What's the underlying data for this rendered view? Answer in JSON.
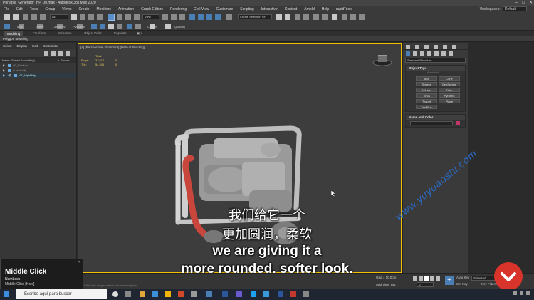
{
  "window": {
    "title": "Portable_Generator_HP_00.max - Autodesk 3ds Max 2020",
    "controls": [
      "–",
      "□",
      "✕"
    ]
  },
  "menu": {
    "items": [
      "File",
      "Edit",
      "Tools",
      "Group",
      "Views",
      "Create",
      "Modifiers",
      "Animation",
      "Graph Editors",
      "Rendering",
      "Civil View",
      "Customize",
      "Scripting",
      "Interactive",
      "Content",
      "Arnold",
      "Help",
      "rapidTools"
    ],
    "workspaces_label": "Workspaces:",
    "workspace_value": "Default"
  },
  "toolbar": {
    "filter_value": "All",
    "view_value": "View",
    "selection_set_value": "Create Selection Se",
    "labels": [
      "8Box",
      "SetPiv",
      "CenterPiv",
      "PivButton",
      "Copitor",
      "Quadrify"
    ]
  },
  "ribbon": {
    "tabs": [
      "Modeling",
      "Freeform",
      "Selection",
      "Object Paint",
      "Populate"
    ],
    "subtab": "Polygon Modeling"
  },
  "explorer": {
    "menu": [
      "Select",
      "Display",
      "Edit",
      "Customize"
    ],
    "col_name": "Name (Sorted Ascending)",
    "col_frozen": "▲ Frozen",
    "rows": [
      "00_Blockout",
      "0 (default)",
      "01_HighPoly"
    ]
  },
  "viewport": {
    "label": "[+] [Perspective] [Standard] [Default Shading]",
    "stats": {
      "total_label": "Total",
      "polys_label": "Polys:",
      "polys_value": "33,517",
      "polys_sel": "0",
      "tris_label": "Tris:",
      "tris_value": "54,206",
      "tris_sel": "0"
    }
  },
  "subtitles": {
    "cn_line1": "我们给它一个",
    "cn_line2": "更加圆润，柔软",
    "en_line1": "we are giving it a",
    "en_line2": "more rounded, softer look,"
  },
  "command_panel": {
    "dropdown": "Standard Primitives",
    "object_type_title": "Object Type",
    "autogrid": "AutoGrid",
    "primitives": [
      "Box",
      "Cone",
      "Sphere",
      "GeoSphere",
      "Cylinder",
      "Tube",
      "Torus",
      "Pyramid",
      "Teapot",
      "Plane",
      "TextPlus"
    ],
    "name_color_title": "Name and Color"
  },
  "status": {
    "grid": "Grid = 10,0cm",
    "add_time_tag": "Add Time Tag",
    "auto_key": "Auto Key",
    "selected": "Selected",
    "set_key": "Set Key",
    "key_filters": "Key Filters...",
    "frame": "0",
    "prompt": "Click and drag to select and move objects"
  },
  "overlay": {
    "line1": "Middle Click",
    "line2": "NumLock",
    "line3": "Middle Click [Hold]"
  },
  "taskbar": {
    "search_placeholder": "Escribe aquí para buscar"
  },
  "watermark": {
    "text": "www.yuyuaoshi.com"
  },
  "colors": {
    "viewport_border": "#f0c000",
    "stats_text": "#e6c65c",
    "accent": "#4a7fb5",
    "logo_red": "#d9342b",
    "watermark_blue": "#2a6fd0"
  }
}
